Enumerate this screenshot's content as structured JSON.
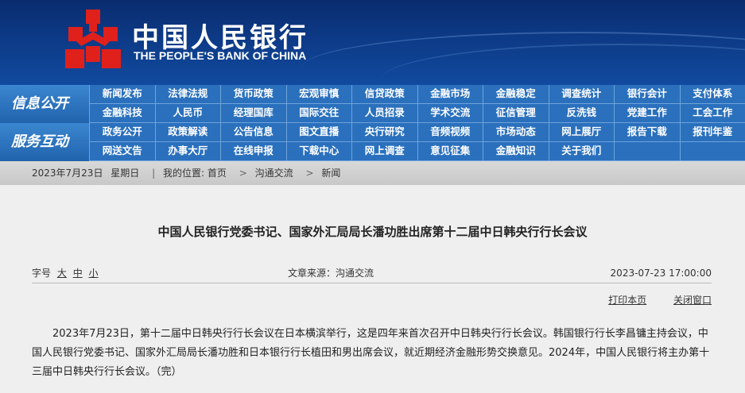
{
  "header": {
    "logo_cn": "中国人民银行",
    "logo_en": "THE PEOPLE'S BANK OF CHINA",
    "emblem_color": "#e0201b"
  },
  "nav": {
    "section1_label": "信息公开",
    "section1_items": [
      "新闻发布",
      "法律法规",
      "货币政策",
      "宏观审慎",
      "信贷政策",
      "金融市场",
      "金融稳定",
      "调查统计",
      "银行会计",
      "支付体系",
      "金融科技",
      "人民币",
      "经理国库",
      "国际交往",
      "人员招录",
      "学术交流",
      "征信管理",
      "反洗钱",
      "党建工作",
      "工会工作"
    ],
    "section2_label": "服务互动",
    "section2_items": [
      "政务公开",
      "政策解读",
      "公告信息",
      "图文直播",
      "央行研究",
      "音频视频",
      "市场动态",
      "网上展厅",
      "报告下载",
      "报刊年鉴",
      "网送文告",
      "办事大厅",
      "在线申报",
      "下载中心",
      "网上调查",
      "意见征集",
      "金融知识",
      "关于我们",
      "",
      ""
    ]
  },
  "breadcrumb": {
    "date": "2023年7月23日",
    "weekday": "星期日",
    "location_label": "我的位置:",
    "home": "首页",
    "level1": "沟通交流",
    "level2": "新闻"
  },
  "article": {
    "title": "中国人民银行党委书记、国家外汇局局长潘功胜出席第十二届中日韩央行行长会议",
    "font_size_label": "字号",
    "font_large": "大",
    "font_medium": "中",
    "font_small": "小",
    "source": "文章来源：沟通交流",
    "datetime": "2023-07-23 17:00:00",
    "print_label": "打印本页",
    "close_label": "关闭窗口",
    "body": "2023年7月23日，第十二届中日韩央行行长会议在日本横滨举行，这是四年来首次召开中日韩央行行长会议。韩国银行行长李昌镛主持会议，中国人民银行党委书记、国家外汇局局长潘功胜和日本银行行长植田和男出席会议，就近期经济金融形势交换意见。2024年，中国人民银行将主办第十三届中日韩央行行长会议。（完）"
  }
}
